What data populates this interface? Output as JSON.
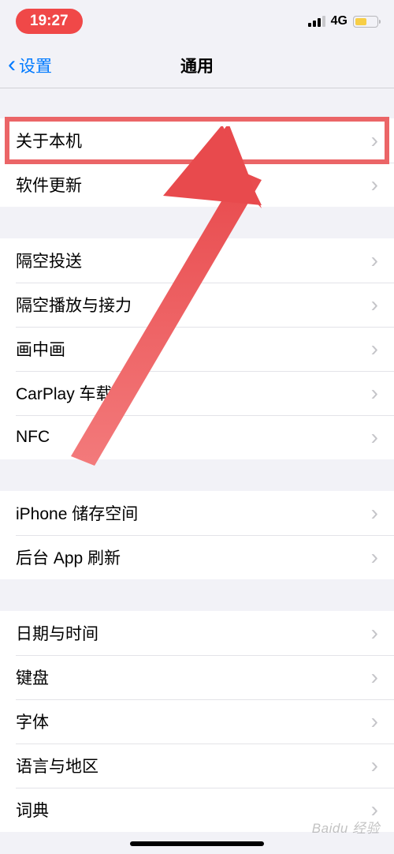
{
  "status": {
    "time": "19:27",
    "network": "4G"
  },
  "nav": {
    "back": "设置",
    "title": "通用"
  },
  "groups": [
    {
      "items": [
        {
          "key": "about",
          "label": "关于本机"
        },
        {
          "key": "software-update",
          "label": "软件更新"
        }
      ]
    },
    {
      "items": [
        {
          "key": "airdrop",
          "label": "隔空投送"
        },
        {
          "key": "airplay-handoff",
          "label": "隔空播放与接力"
        },
        {
          "key": "pip",
          "label": "画中画"
        },
        {
          "key": "carplay",
          "label": "CarPlay 车载"
        },
        {
          "key": "nfc",
          "label": "NFC"
        }
      ]
    },
    {
      "items": [
        {
          "key": "iphone-storage",
          "label": "iPhone 储存空间"
        },
        {
          "key": "background-refresh",
          "label": "后台 App 刷新"
        }
      ]
    },
    {
      "items": [
        {
          "key": "date-time",
          "label": "日期与时间"
        },
        {
          "key": "keyboard",
          "label": "键盘"
        },
        {
          "key": "fonts",
          "label": "字体"
        },
        {
          "key": "language-region",
          "label": "语言与地区"
        },
        {
          "key": "dictionary",
          "label": "词典"
        }
      ]
    }
  ],
  "watermark": "Baidu 经验"
}
